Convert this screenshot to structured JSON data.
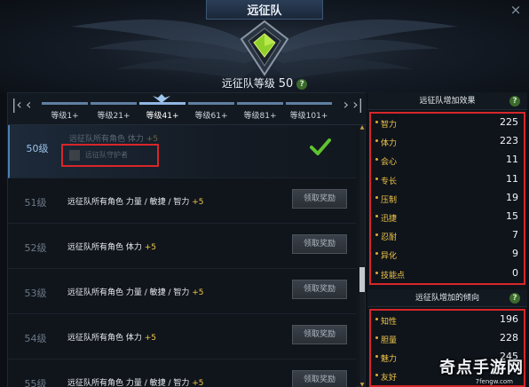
{
  "window": {
    "title": "远征队",
    "close_label": "×"
  },
  "header": {
    "level_label": "远征队等级",
    "level_value": "50",
    "help": "?"
  },
  "tabs": {
    "first_label": "|‹",
    "prev_label": "‹",
    "next_label": "›",
    "last_label": "›|",
    "items": [
      {
        "label": "等级1+",
        "active": false
      },
      {
        "label": "等级21+",
        "active": false
      },
      {
        "label": "等级41+",
        "active": true
      },
      {
        "label": "等级61+",
        "active": false
      },
      {
        "label": "等级81+",
        "active": false
      },
      {
        "label": "等级101+",
        "active": false
      }
    ]
  },
  "rewards": [
    {
      "level": "50级",
      "desc": "远征队所有角色 体力",
      "bonus": "+5",
      "claimed": true,
      "status_text": "远征队守护者"
    },
    {
      "level": "51级",
      "desc": "远征队所有角色 力量 / 敏捷 / 智力",
      "bonus": "+5",
      "button": "领取奖励"
    },
    {
      "level": "52级",
      "desc": "远征队所有角色 体力",
      "bonus": "+5",
      "button": "领取奖励"
    },
    {
      "level": "53级",
      "desc": "远征队所有角色 力量 / 敏捷 / 智力",
      "bonus": "+5",
      "button": "领取奖励"
    },
    {
      "level": "54级",
      "desc": "远征队所有角色 体力",
      "bonus": "+5",
      "button": "领取奖励"
    },
    {
      "level": "55级",
      "desc": "远征队所有角色 力量 / 敏捷 / 智力",
      "bonus": "+5",
      "button": "领取奖励"
    }
  ],
  "effects": {
    "title": "远征队增加效果",
    "help": "?",
    "stats": [
      {
        "label": "智力",
        "value": "225"
      },
      {
        "label": "体力",
        "value": "223"
      },
      {
        "label": "会心",
        "value": "11"
      },
      {
        "label": "专长",
        "value": "11"
      },
      {
        "label": "压制",
        "value": "19"
      },
      {
        "label": "迅捷",
        "value": "15"
      },
      {
        "label": "忍耐",
        "value": "7"
      },
      {
        "label": "异化",
        "value": "9"
      },
      {
        "label": "技能点",
        "value": "0"
      }
    ]
  },
  "tendency": {
    "title": "远征队增加的倾向",
    "help": "?",
    "stats": [
      {
        "label": "知性",
        "value": "196"
      },
      {
        "label": "胆量",
        "value": "228"
      },
      {
        "label": "魅力",
        "value": "245"
      },
      {
        "label": "友好",
        "value": ""
      }
    ]
  },
  "watermark": {
    "main": "奇点手游网",
    "sub": "7fengw.com"
  }
}
